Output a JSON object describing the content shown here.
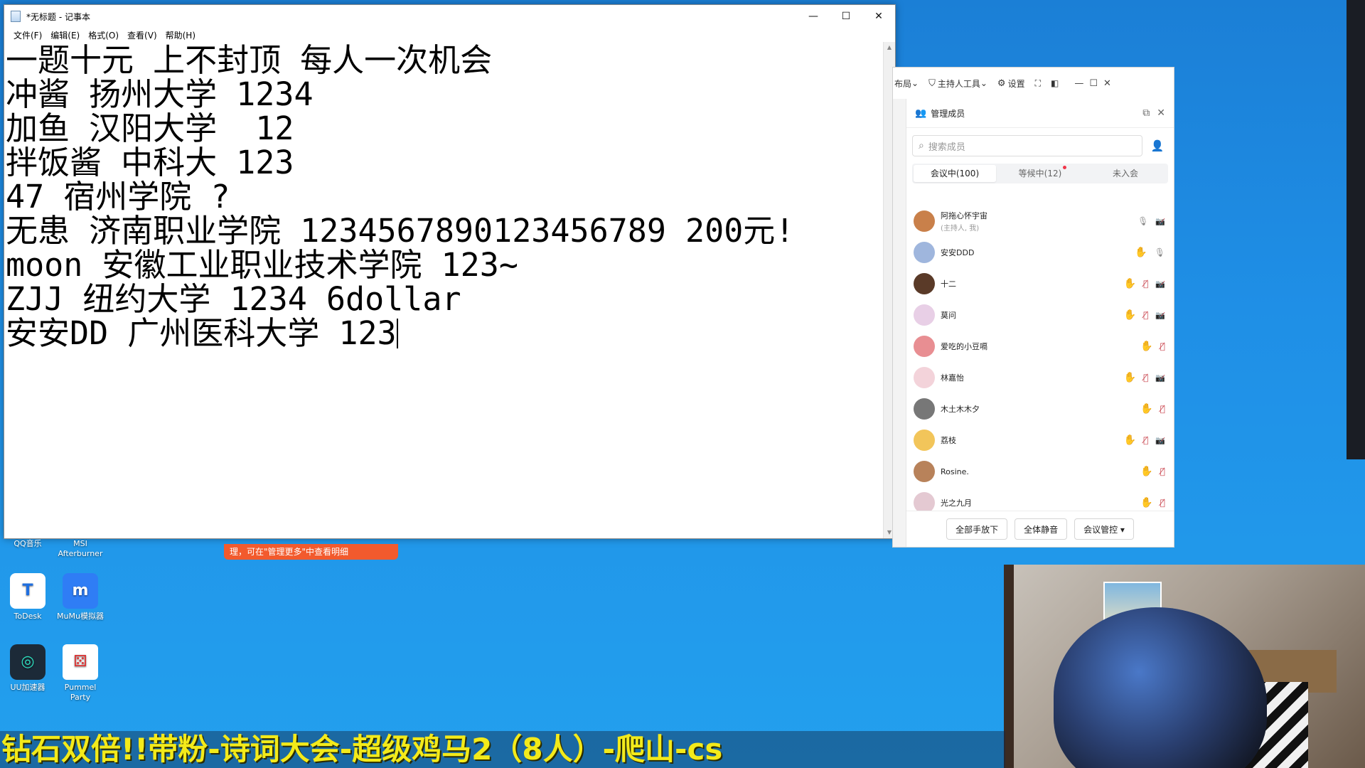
{
  "notepad": {
    "title": "*无标题 - 记事本",
    "controls": {
      "minimize": "—",
      "maximize": "☐",
      "close": "✕"
    },
    "menus": [
      "文件(F)",
      "编辑(E)",
      "格式(O)",
      "查看(V)",
      "帮助(H)"
    ],
    "lines": [
      "一题十元 上不封顶 每人一次机会",
      "冲酱 扬州大学 1234",
      "加鱼 汉阳大学  12",
      "拌饭酱 中科大 123",
      "47 宿州学院 ?",
      "无患 济南职业学院 1234567890123456789 200元!",
      "moon 安徽工业职业技术学院 123~",
      "ZJJ 纽约大学 1234 6dollar",
      "安安DD 广州医科大学 123"
    ]
  },
  "meeting": {
    "toolbar": {
      "layout": "布局",
      "host_tools": "主持人工具",
      "settings": "设置"
    },
    "panel_title": "管理成员",
    "search_placeholder": "搜索成员",
    "tabs": {
      "in_meeting": "会议中(100)",
      "waiting": "等候中(12)",
      "not_joined": "未入会"
    },
    "members": [
      {
        "name": "阿拖心怀宇宙",
        "role": "(主持人, 我)",
        "hand": false,
        "mic": "on",
        "cam": "off",
        "color": "#c9804a"
      },
      {
        "name": "安安DDD",
        "role": "",
        "hand": true,
        "mic": "on",
        "cam": "none",
        "color": "#9fb6dd"
      },
      {
        "name": "十二",
        "role": "",
        "hand": true,
        "mic": "off",
        "cam": "off",
        "color": "#5a3a28"
      },
      {
        "name": "莫问",
        "role": "",
        "hand": true,
        "mic": "off",
        "cam": "off",
        "color": "#e8cfe6"
      },
      {
        "name": "爱吃的小豆嗝",
        "role": "",
        "hand": true,
        "mic": "off",
        "cam": "none",
        "color": "#e88e92"
      },
      {
        "name": "林嘉怡",
        "role": "",
        "hand": true,
        "mic": "off",
        "cam": "off",
        "color": "#f3d3da"
      },
      {
        "name": "木土木木夕",
        "role": "",
        "hand": true,
        "mic": "off",
        "cam": "none",
        "color": "#777777"
      },
      {
        "name": "荔枝",
        "role": "",
        "hand": true,
        "mic": "off",
        "cam": "off",
        "color": "#f2c55a"
      },
      {
        "name": "Rosine.",
        "role": "",
        "hand": true,
        "mic": "off",
        "cam": "none",
        "color": "#b8825a"
      },
      {
        "name": "光之九月",
        "role": "",
        "hand": true,
        "mic": "off",
        "cam": "none",
        "color": "#e4c9d2"
      }
    ],
    "footer_buttons": {
      "lower_all": "全部手放下",
      "mute_all": "全体静音",
      "control": "会议管控 ▾"
    }
  },
  "desktop": {
    "icons": [
      {
        "label": "QQ音乐"
      },
      {
        "label": "MSI Afterburner"
      },
      {
        "label": "ToDesk"
      },
      {
        "label": "MuMu模拟器"
      },
      {
        "label": "UU加速器"
      },
      {
        "label": "Pummel Party"
      }
    ],
    "toast": "理，可在\"管理更多\"中查看明细"
  },
  "banner": "钻石双倍!!带粉-诗词大会-超级鸡马2（8人）-爬山-cs"
}
